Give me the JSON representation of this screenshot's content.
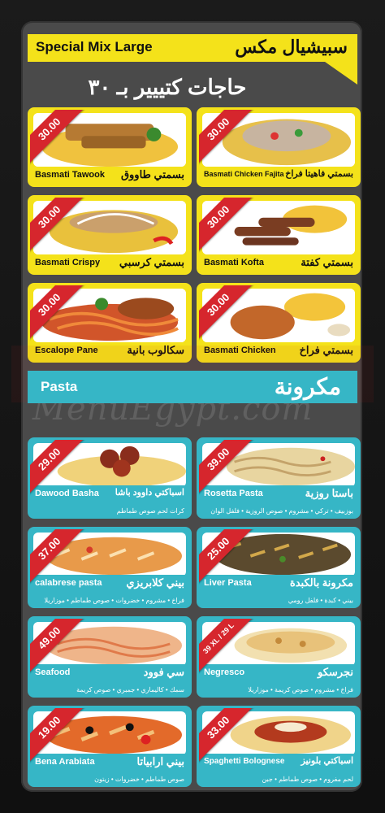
{
  "header": {
    "title_en": "Special Mix Large",
    "title_ar": "سبيشيال مكس",
    "price_heading": "حاجات كتييير بـ ٣٠"
  },
  "special_items": [
    {
      "en": "Basmati Tawook",
      "ar": "بسمتي طاووق",
      "price": "30.00"
    },
    {
      "en": "Basmati Chicken Fajita",
      "ar": "بسمتي فاهيتا فراخ",
      "price": "30.00"
    },
    {
      "en": "Basmati Crispy",
      "ar": "بسمتي كرسبي",
      "price": "30.00"
    },
    {
      "en": "Basmati Kofta",
      "ar": "بسمتي كفتة",
      "price": "30.00"
    },
    {
      "en": "Escalope Pane",
      "ar": "سكالوب بانية",
      "price": "30.00"
    },
    {
      "en": "Basmati Chicken",
      "ar": "بسمتي فراخ",
      "price": "30.00"
    }
  ],
  "pasta_section": {
    "title_en": "Pasta",
    "title_ar": "مكرونة"
  },
  "pasta_items": [
    {
      "en": "Dawood Basha",
      "ar": "اسباكتي داوود باشا",
      "price": "29.00",
      "desc": "كرات لحم صوص طماطم"
    },
    {
      "en": "Rosetta Pasta",
      "ar": "باستا روزية",
      "price": "39.00",
      "desc": "بوزبيف • تركي • مشروم • صوص الروزية • فلفل الوان"
    },
    {
      "en": "calabrese pasta",
      "ar": "بيني كلابريزي",
      "price": "37.00",
      "desc": "فراخ • مشروم • خضروات • صوص طماطم • موزاريلا"
    },
    {
      "en": "Liver Pasta",
      "ar": "مكرونة بالكبدة",
      "price": "25.00",
      "desc": "بيني • كبدة • فلفل رومي"
    },
    {
      "en": "Seafood",
      "ar": "سي فوود",
      "price": "49.00",
      "desc": "سمك • كاليماري • جمبري • صوص كريمة"
    },
    {
      "en": "Negresco",
      "ar": "نجرسكو",
      "price": "39 XL / 29 L",
      "desc": "فراخ • مشروم • صوص كريمة • موزاريلا"
    },
    {
      "en": "Bena Arabiata",
      "ar": "بيني ارابياتا",
      "price": "19.00",
      "desc": "صوص طماطم • خضروات • زيتون"
    },
    {
      "en": "Spaghetti Bolognese",
      "ar": "اسباكتي بلونيز",
      "price": "33.00",
      "desc": "لحم مفروم • صوص طماطم • جبن"
    }
  ],
  "watermark": "MenuEgypt.com",
  "colors": {
    "yellow": "#f4e21a",
    "teal": "#36b6c6",
    "ribbon_red": "#d6262d",
    "card_gray": "#4a4a4a"
  }
}
